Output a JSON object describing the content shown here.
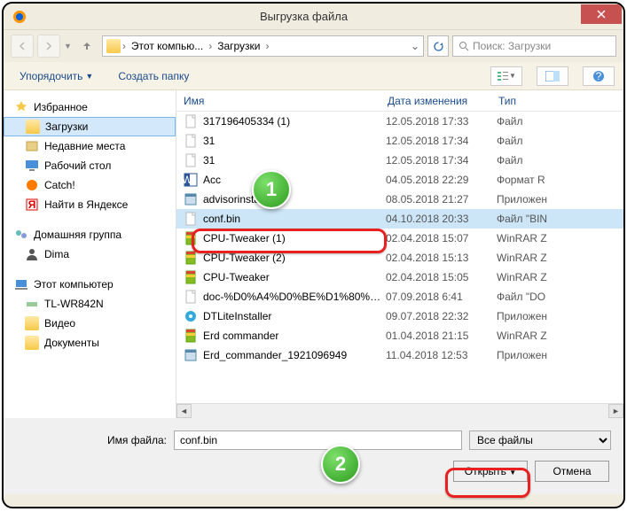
{
  "window": {
    "title": "Выгрузка файла"
  },
  "path": {
    "seg1": "Этот компью...",
    "seg2": "Загрузки"
  },
  "search": {
    "placeholder": "Поиск: Загрузки"
  },
  "toolbar": {
    "organize": "Упорядочить",
    "newfolder": "Создать папку"
  },
  "sidebar": {
    "favorites": "Избранное",
    "items_fav": [
      "Загрузки",
      "Недавние места",
      "Рабочий стол",
      "Catch!",
      "Найти в Яндексе"
    ],
    "homegroup": "Домашняя группа",
    "items_hg": [
      "Dima"
    ],
    "thispc": "Этот компьютер",
    "items_pc": [
      "TL-WR842N",
      "Видео",
      "Документы"
    ]
  },
  "columns": {
    "name": "Имя",
    "date": "Дата изменения",
    "type": "Тип"
  },
  "files": [
    {
      "name": "317196405334 (1)",
      "date": "12.05.2018 17:33",
      "type": "Файл",
      "icon": "file"
    },
    {
      "name": "31",
      "date": "12.05.2018 17:34",
      "type": "Файл",
      "icon": "file"
    },
    {
      "name": "31",
      "date": "12.05.2018 17:34",
      "type": "Файл",
      "icon": "file"
    },
    {
      "name": "Acc",
      "date": "04.05.2018 22:29",
      "type": "Формат R",
      "icon": "word"
    },
    {
      "name": "advisorinstaller",
      "date": "08.05.2018 21:27",
      "type": "Приложен",
      "icon": "app"
    },
    {
      "name": "conf.bin",
      "date": "04.10.2018 20:33",
      "type": "Файл \"BIN",
      "icon": "file",
      "selected": true
    },
    {
      "name": "CPU-Tweaker (1)",
      "date": "02.04.2018 15:07",
      "type": "WinRAR Z",
      "icon": "rar"
    },
    {
      "name": "CPU-Tweaker (2)",
      "date": "02.04.2018 15:13",
      "type": "WinRAR Z",
      "icon": "rar"
    },
    {
      "name": "CPU-Tweaker",
      "date": "02.04.2018 15:05",
      "type": "WinRAR Z",
      "icon": "rar"
    },
    {
      "name": "doc-%D0%A4%D0%BE%D1%80%D0%BC...",
      "date": "07.09.2018 6:41",
      "type": "Файл \"DO",
      "icon": "file"
    },
    {
      "name": "DTLiteInstaller",
      "date": "09.07.2018 22:32",
      "type": "Приложен",
      "icon": "dt"
    },
    {
      "name": "Erd commander",
      "date": "01.04.2018 21:15",
      "type": "WinRAR Z",
      "icon": "rar"
    },
    {
      "name": "Erd_commander_1921096949",
      "date": "11.04.2018 12:53",
      "type": "Приложен",
      "icon": "app"
    }
  ],
  "bottom": {
    "filename_label": "Имя файла:",
    "filename_value": "conf.bin",
    "filter": "Все файлы",
    "open": "Открыть",
    "cancel": "Отмена"
  }
}
